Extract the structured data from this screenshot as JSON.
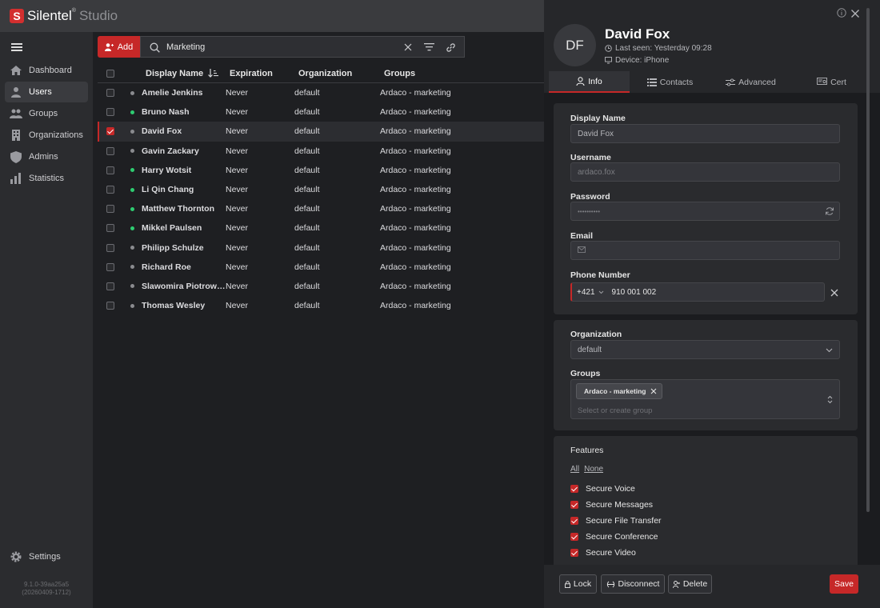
{
  "app": {
    "brand": "Silentel",
    "brand_mark": "®",
    "sub": "Studio",
    "logo_letter": "S"
  },
  "sidebar": {
    "items": [
      {
        "label": "Dashboard",
        "icon": "home-icon"
      },
      {
        "label": "Users",
        "icon": "user-icon"
      },
      {
        "label": "Groups",
        "icon": "group-icon"
      },
      {
        "label": "Organizations",
        "icon": "building-icon"
      },
      {
        "label": "Admins",
        "icon": "shield-icon"
      },
      {
        "label": "Statistics",
        "icon": "bar-chart-icon"
      }
    ],
    "settings_label": "Settings",
    "version_line1": "9.1.0-39aa25a5",
    "version_line2": "(20260409-1712)"
  },
  "toolbar": {
    "add_label": "Add",
    "search_value": "Marketing"
  },
  "table": {
    "headers": {
      "name": "Display Name",
      "expiration": "Expiration",
      "organization": "Organization",
      "groups": "Groups"
    },
    "rows": [
      {
        "name": "Amelie Jenkins",
        "exp": "Never",
        "org": "default",
        "grp": "Ardaco - marketing",
        "status": "offline"
      },
      {
        "name": "Bruno Nash",
        "exp": "Never",
        "org": "default",
        "grp": "Ardaco - marketing",
        "status": "online"
      },
      {
        "name": "David Fox",
        "exp": "Never",
        "org": "default",
        "grp": "Ardaco - marketing",
        "status": "offline",
        "selected": true
      },
      {
        "name": "Gavin Zackary",
        "exp": "Never",
        "org": "default",
        "grp": "Ardaco - marketing",
        "status": "offline"
      },
      {
        "name": "Harry Wotsit",
        "exp": "Never",
        "org": "default",
        "grp": "Ardaco - marketing",
        "status": "online"
      },
      {
        "name": "Li Qin Chang",
        "exp": "Never",
        "org": "default",
        "grp": "Ardaco - marketing",
        "status": "online"
      },
      {
        "name": "Matthew Thornton",
        "exp": "Never",
        "org": "default",
        "grp": "Ardaco - marketing",
        "status": "online"
      },
      {
        "name": "Mikkel Paulsen",
        "exp": "Never",
        "org": "default",
        "grp": "Ardaco - marketing",
        "status": "online"
      },
      {
        "name": "Philipp Schulze",
        "exp": "Never",
        "org": "default",
        "grp": "Ardaco - marketing",
        "status": "offline"
      },
      {
        "name": "Richard Roe",
        "exp": "Never",
        "org": "default",
        "grp": "Ardaco - marketing",
        "status": "offline"
      },
      {
        "name": "Slawomira Piotrows...",
        "exp": "Never",
        "org": "default",
        "grp": "Ardaco - marketing",
        "status": "offline"
      },
      {
        "name": "Thomas Wesley",
        "exp": "Never",
        "org": "default",
        "grp": "Ardaco - marketing",
        "status": "offline"
      }
    ]
  },
  "detail": {
    "initials": "DF",
    "name": "David Fox",
    "last_seen": "Last seen: Yesterday 09:28",
    "device": "Device: iPhone",
    "tabs": [
      "Info",
      "Contacts",
      "Advanced",
      "Cert"
    ],
    "display_name_label": "Display Name",
    "display_name_value": "David Fox",
    "username_label": "Username",
    "username_value": "ardaco.fox",
    "password_label": "Password",
    "password_value": "••••••••••",
    "email_label": "Email",
    "phone_label": "Phone Number",
    "phone_prefix": "+421",
    "phone_value": "910 001 002",
    "organization_label": "Organization",
    "organization_value": "default",
    "groups_label": "Groups",
    "group_chip": "Ardaco - marketing",
    "groups_placeholder": "Select or create group",
    "features_label": "Features",
    "all_label": "All",
    "none_label": "None",
    "features": [
      "Secure Voice",
      "Secure Messages",
      "Secure File Transfer",
      "Secure Conference",
      "Secure Video"
    ],
    "lock_label": "Lock",
    "disconnect_label": "Disconnect",
    "delete_label": "Delete",
    "save_label": "Save"
  },
  "colors": {
    "accent": "#c62828",
    "online": "#2ecc71",
    "offline": "#8a8b8f"
  }
}
